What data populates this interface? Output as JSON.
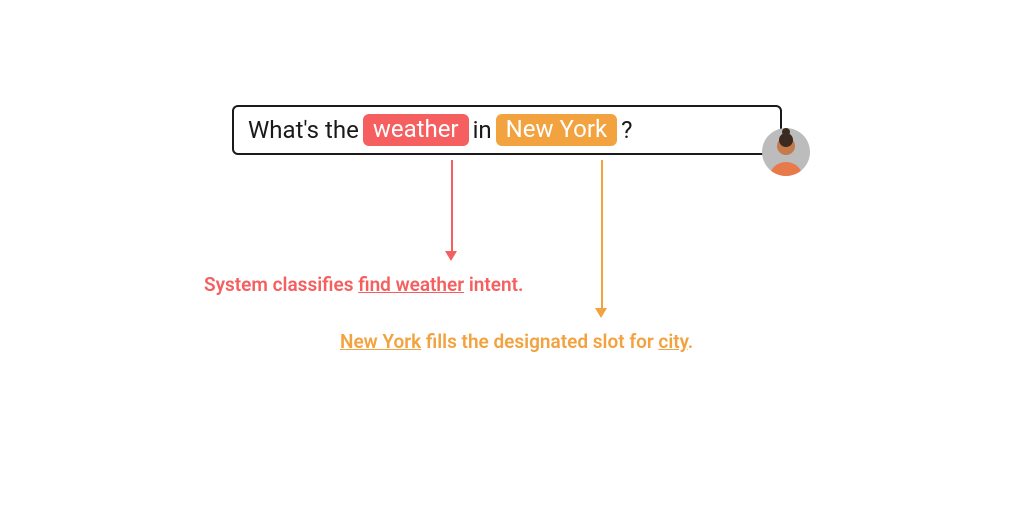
{
  "query": {
    "prefix": "What's the",
    "intent_word": "weather",
    "middle": "in",
    "slot_word": "New York",
    "suffix": "?"
  },
  "colors": {
    "intent": "#f55f5f",
    "slot": "#f2a23f"
  },
  "labels": {
    "intent": {
      "pre": "System classifies ",
      "u1": "find weather",
      "post": " intent."
    },
    "slot": {
      "u1": "New York",
      "mid": " fills the designated slot for ",
      "u2": "city",
      "post": "."
    }
  }
}
